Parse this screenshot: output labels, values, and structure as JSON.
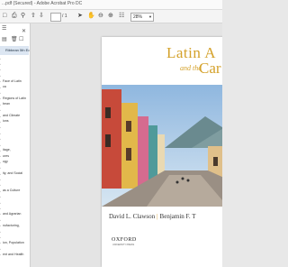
{
  "window": {
    "title": "...pdf (Secured) - Adobe Acrobat Pro DC"
  },
  "toolbar": {
    "page_current": "",
    "page_total": "/ 1",
    "zoom": "28%"
  },
  "bookmarks": {
    "items": [
      {
        "label": "Ribbean 5th Ed",
        "selected": true
      },
      {
        "label": ""
      },
      {
        "label": ""
      },
      {
        "label": ""
      },
      {
        "label": ""
      },
      {
        "label": "Face of Latin"
      },
      {
        "label": "ca"
      },
      {
        "label": ""
      },
      {
        "label": "Regions of Latin"
      },
      {
        "label": "bean"
      },
      {
        "label": ""
      },
      {
        "label": "and Climate"
      },
      {
        "label": "ions"
      },
      {
        "label": ""
      },
      {
        "label": ""
      },
      {
        "label": ""
      },
      {
        "label": ""
      },
      {
        "label": "itage,"
      },
      {
        "label": "ures"
      },
      {
        "label": "ogy"
      },
      {
        "label": ""
      },
      {
        "label": "ity, and Social"
      },
      {
        "label": ""
      },
      {
        "label": ""
      },
      {
        "label": "as a Culture"
      },
      {
        "label": ""
      },
      {
        "label": ""
      },
      {
        "label": ""
      },
      {
        "label": "and Agrarian"
      },
      {
        "label": ""
      },
      {
        "label": "nufacturing,"
      },
      {
        "label": ""
      },
      {
        "label": ""
      },
      {
        "label": "ion, Population"
      },
      {
        "label": ""
      },
      {
        "label": "ent and Health"
      }
    ]
  },
  "cover": {
    "title_line1": "Latin A",
    "title_and": "and the",
    "title_line2": "Car",
    "authors_1": "David L. Clawson",
    "authors_sep": "|",
    "authors_2": "Benjamin F. T",
    "publisher": "OXFORD",
    "publisher_sub": "UNIVERSITY PRESS"
  },
  "colors": {
    "accent": "#d4a12a",
    "bookmark_selected": "#dce6f2"
  }
}
